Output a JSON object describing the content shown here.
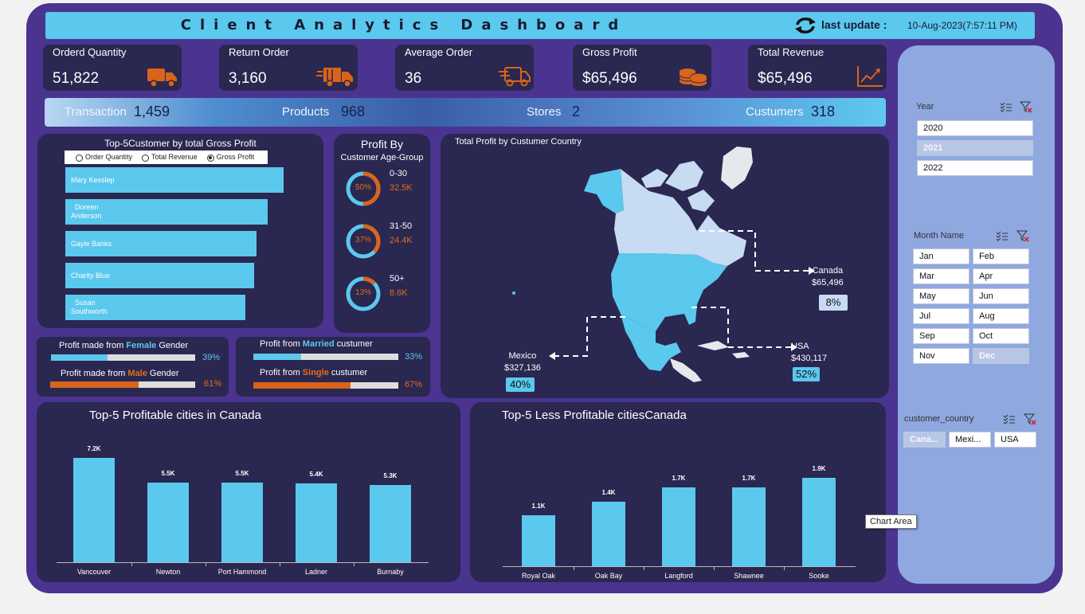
{
  "header": {
    "title": "Client Analytics Dashboard",
    "update_label": "last update :",
    "update_value": "10-Aug-2023(7:57:11 PM)"
  },
  "kpis": [
    {
      "label": "Orderd Quantity",
      "value": "51,822",
      "icon": "truck-icon"
    },
    {
      "label": "Return Order",
      "value": "3,160",
      "icon": "delivery-truck-icon"
    },
    {
      "label": "Average Order",
      "value": "36",
      "icon": "fast-delivery-icon"
    },
    {
      "label": "Gross Profit",
      "value": "$65,496",
      "icon": "coins-icon"
    },
    {
      "label": "Total Revenue",
      "value": "$65,496",
      "icon": "growth-chart-icon"
    }
  ],
  "stats": [
    {
      "label": "Transaction",
      "value": "1,459"
    },
    {
      "label": "Products",
      "value": "968"
    },
    {
      "label": "Stores",
      "value": "2"
    },
    {
      "label": "Custumers",
      "value": "318"
    }
  ],
  "top_customers": {
    "title": "Top-5Customer by total Gross Profit",
    "options": [
      "Order Quantity",
      "Total Revenue",
      "Gross Profit"
    ],
    "selected": "Gross Profit",
    "rows": [
      {
        "name": "Mary Kesslep",
        "name2": "",
        "value": 0.97
      },
      {
        "name": "Doreen",
        "name2": "Anderson",
        "value": 0.9
      },
      {
        "name": "Gayle Banks",
        "name2": "",
        "value": 0.85
      },
      {
        "name": "Charity Blue",
        "name2": "",
        "value": 0.84
      },
      {
        "name": "Susan",
        "name2": "Southworth",
        "value": 0.8
      }
    ]
  },
  "age_group": {
    "title": "Profit By",
    "subtitle": "Customer  Age-Group",
    "items": [
      {
        "group": "0-30",
        "pct": "50%",
        "share": 0.5,
        "value": "32.5K"
      },
      {
        "group": "31-50",
        "pct": "37%",
        "share": 0.37,
        "value": "24.4K"
      },
      {
        "group": "50+",
        "pct": "13%",
        "share": 0.13,
        "value": "8.6K"
      }
    ]
  },
  "gender": {
    "female_prefix": "Profit made from ",
    "female_word": "Female",
    "female_suffix": " Gender",
    "female_pct": "39%",
    "female_share": 0.39,
    "male_prefix": "Profit made from ",
    "male_word": "Male",
    "male_suffix": " Gender",
    "male_pct": "61%",
    "male_share": 0.61
  },
  "marital": {
    "married_prefix": "Profit from ",
    "married_word": "Married",
    "married_suffix": " custumer",
    "married_pct": "33%",
    "married_share": 0.33,
    "single_prefix": "Profit from ",
    "single_word": "Single",
    "single_suffix": " custumer",
    "single_pct": "67%",
    "single_share": 0.67
  },
  "map": {
    "title": "Total Profit by Custumer Country",
    "countries": [
      {
        "name": "Canada",
        "profit": "$65,496",
        "pct": "8%"
      },
      {
        "name": "USA",
        "profit": "$430,117",
        "pct": "52%"
      },
      {
        "name": "Mexico",
        "profit": "$327,136",
        "pct": "40%"
      }
    ]
  },
  "chart_data": [
    {
      "type": "bar",
      "title": "Top-5 Profitable cities in  Canada",
      "categories": [
        "Vancouver",
        "Newton",
        "Port Hammond",
        "Ladner",
        "Burnaby"
      ],
      "values": [
        7.2,
        5.5,
        5.5,
        5.4,
        5.3
      ],
      "labels": [
        "7.2K",
        "5.5K",
        "5.5K",
        "5.4K",
        "5.3K"
      ],
      "ylim": [
        0,
        8
      ]
    },
    {
      "type": "bar",
      "title": "Top-5  Less Profitable citiesCanada",
      "categories": [
        "Royal Oak",
        "Oak Bay",
        "Langford",
        "Shawnee",
        "Sooke"
      ],
      "values": [
        1.1,
        1.4,
        1.7,
        1.7,
        1.9
      ],
      "labels": [
        "1.1K",
        "1.4K",
        "1.7K",
        "1.7K",
        "1.9K"
      ],
      "ylim": [
        0,
        2.2
      ]
    }
  ],
  "slicers": {
    "year": {
      "title": "Year",
      "items": [
        "2020",
        "2021",
        "2022"
      ],
      "dimmed": [
        "2021"
      ]
    },
    "month": {
      "title": "Month Name",
      "items": [
        "Jan",
        "Feb",
        "Mar",
        "Apr",
        "May",
        "Jun",
        "Jul",
        "Aug",
        "Sep",
        "Oct",
        "Nov",
        "Dec"
      ],
      "dimmed": [
        "Dec"
      ]
    },
    "country": {
      "title": "customer_country",
      "items": [
        "Cana...",
        "Mexi...",
        "USA"
      ],
      "dimmed": [
        "Cana..."
      ]
    }
  },
  "tooltip": "Chart Area",
  "colors": {
    "accent": "#5bc8ee",
    "orange": "#e06e1c",
    "panel": "#2a2750",
    "frame": "#4a3490"
  }
}
